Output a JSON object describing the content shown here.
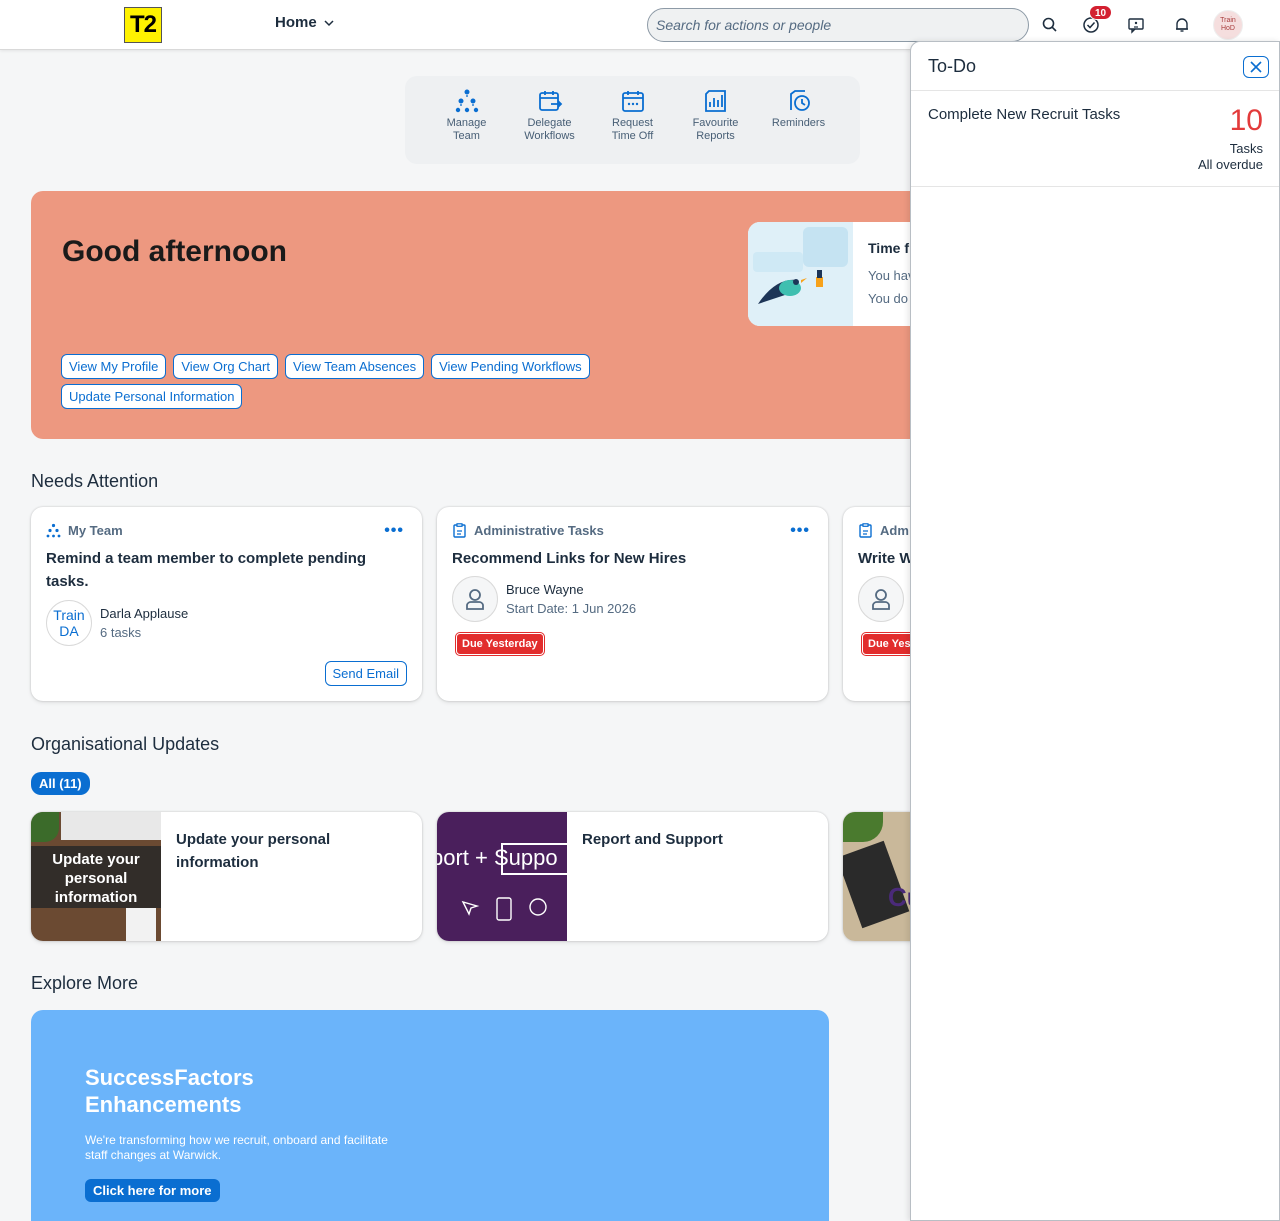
{
  "header": {
    "logo": "T2",
    "home_menu": "Home",
    "search_placeholder": "Search for actions or people",
    "todo_badge": "10",
    "avatar_line1": "Train",
    "avatar_line2": "HoD"
  },
  "quick_actions": [
    {
      "line1": "Manage",
      "line2": "Team"
    },
    {
      "line1": "Delegate",
      "line2": "Workflows"
    },
    {
      "line1": "Request",
      "line2": "Time Off"
    },
    {
      "line1": "Favourite",
      "line2": "Reports"
    },
    {
      "line1": "Reminders",
      "line2": ""
    }
  ],
  "hero": {
    "greeting": "Good afternoon",
    "links": [
      "View My Profile",
      "View Org Chart",
      "View Team Absences",
      "View Pending Workflows",
      "Update Personal Information"
    ],
    "card_title": "Time f",
    "card_line1": "You hav",
    "card_line2": "You do"
  },
  "needs_attention": {
    "title": "Needs Attention",
    "cards": [
      {
        "category": "My Team",
        "title": "Remind a team member to complete pending tasks.",
        "person_initials_1": "Train",
        "person_initials_2": "DA",
        "person_name": "Darla Applause",
        "person_sub": "6 tasks",
        "action": "Send Email"
      },
      {
        "category": "Administrative Tasks",
        "title": "Recommend Links for New Hires",
        "person_name": "Bruce Wayne",
        "person_sub": "Start Date: 1 Jun 2026",
        "due": "Due Yesterday"
      },
      {
        "category": "Adm",
        "title": "Write W",
        "due": "Due Yes"
      }
    ]
  },
  "org_updates": {
    "title": "Organisational Updates",
    "filter": "All (11)",
    "cards": [
      {
        "image_text": "Update your personal information",
        "title": "Update your personal information"
      },
      {
        "image_text": "port + Suppo",
        "title": "Report and Support"
      },
      {
        "image_text": "Cu",
        "title": ""
      }
    ]
  },
  "explore": {
    "title": "Explore More",
    "heading_line1": "SuccessFactors",
    "heading_line2": "Enhancements",
    "text": "We're transforming how we recruit, onboard and facilitate staff changes at Warwick.",
    "button": "Click here for more"
  },
  "todo": {
    "title": "To-Do",
    "item_name": "Complete New Recruit Tasks",
    "item_count": "10",
    "item_unit": "Tasks",
    "item_status": "All overdue"
  },
  "colors": {
    "accent": "#0a6ed1",
    "hero": "#ed9880",
    "due": "#e22d2d",
    "explore": "#6bb4fa"
  }
}
